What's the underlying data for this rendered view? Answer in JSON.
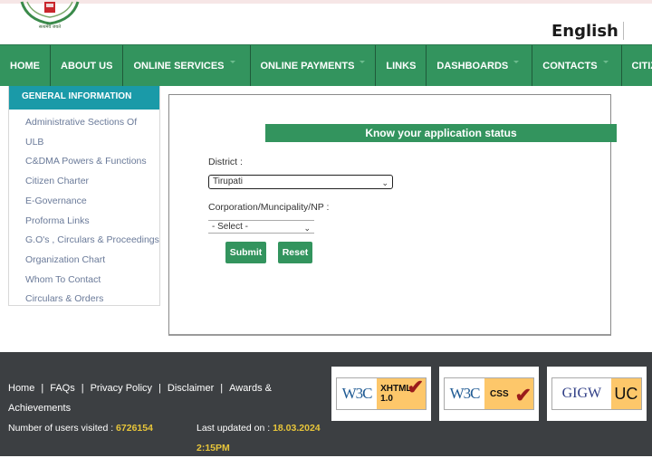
{
  "header": {
    "language": "English"
  },
  "nav": {
    "items": [
      {
        "label": "HOME",
        "dropdown": false
      },
      {
        "label": "ABOUT US",
        "dropdown": false
      },
      {
        "label": "ONLINE SERVICES",
        "dropdown": true
      },
      {
        "label": "ONLINE PAYMENTS",
        "dropdown": true
      },
      {
        "label": "LINKS",
        "dropdown": false
      },
      {
        "label": "DASHBOARDS",
        "dropdown": true
      },
      {
        "label": "CONTACTS",
        "dropdown": true
      },
      {
        "label": "CITIZEN LOGIN",
        "dropdown": false
      }
    ]
  },
  "sidebar": {
    "title": "GENERAL INFORMATION",
    "items": [
      "Administrative Sections Of",
      "ULB",
      "C&DMA Powers & Functions",
      "Citizen Charter",
      "E-Governance",
      "Proforma Links",
      "G.O's , Circulars & Proceedings",
      "Organization Chart",
      "Whom To Contact",
      "Circulars & Orders"
    ]
  },
  "form": {
    "title": "Know your application status",
    "district_label": "District :",
    "district_value": "Tirupati",
    "corp_label": "Corporation/Muncipality/NP :",
    "corp_value": "- Select -",
    "submit_label": "Submit",
    "reset_label": "Reset"
  },
  "footer": {
    "links": [
      "Home",
      "FAQs",
      "Privacy Policy",
      "Disclaimer",
      "Awards & Achievements"
    ],
    "visitors_label": "Number of users visited : ",
    "visitors_value": "6726154",
    "updated_label": "Last updated on : ",
    "updated_value": "18.03.2024 2:15PM",
    "badges": [
      {
        "left": "W3C",
        "right": "XHTML 1.0",
        "check": true
      },
      {
        "left": "W3C",
        "right": "CSS",
        "check": true
      },
      {
        "left": "GIGW",
        "right": "UC",
        "check": false
      }
    ]
  },
  "colors": {
    "nav_green": "#33945e",
    "sidebar_teal": "#1a9aa8",
    "footer_bg": "#3c3f42",
    "highlight_yellow": "#e7c53a"
  }
}
